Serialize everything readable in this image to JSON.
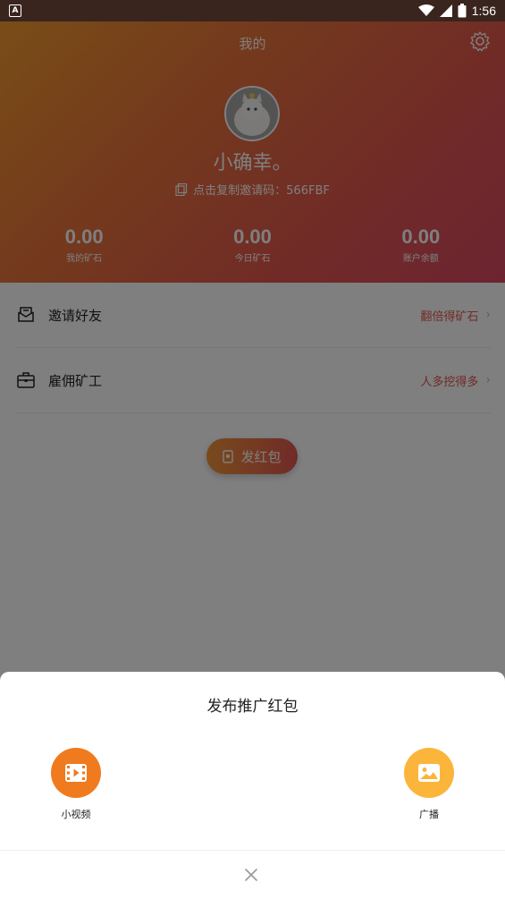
{
  "status_bar": {
    "time": "1:56",
    "notification_glyph": "A"
  },
  "header": {
    "title": "我的",
    "username": "小确幸。",
    "invite_text": "点击复制邀请码：566FBF",
    "stats": [
      {
        "value": "0.00",
        "label": "我的矿石"
      },
      {
        "value": "0.00",
        "label": "今日矿石"
      },
      {
        "value": "0.00",
        "label": "账户余额"
      }
    ],
    "gradient": [
      "#f39a2e",
      "#e2564f",
      "#d94962"
    ]
  },
  "list": [
    {
      "label": "邀请好友",
      "hint": "翻倍得矿石",
      "icon": "envelope-icon"
    },
    {
      "label": "雇佣矿工",
      "hint": "人多挖得多",
      "icon": "briefcase-icon"
    }
  ],
  "red_packet_button": {
    "label": "发红包"
  },
  "sheet": {
    "title": "发布推广红包",
    "options": [
      {
        "label": "小视频",
        "color": "#f07a1e",
        "icon": "video-icon"
      },
      {
        "label": "广播",
        "color": "#fbb53a",
        "icon": "image-icon"
      }
    ]
  }
}
